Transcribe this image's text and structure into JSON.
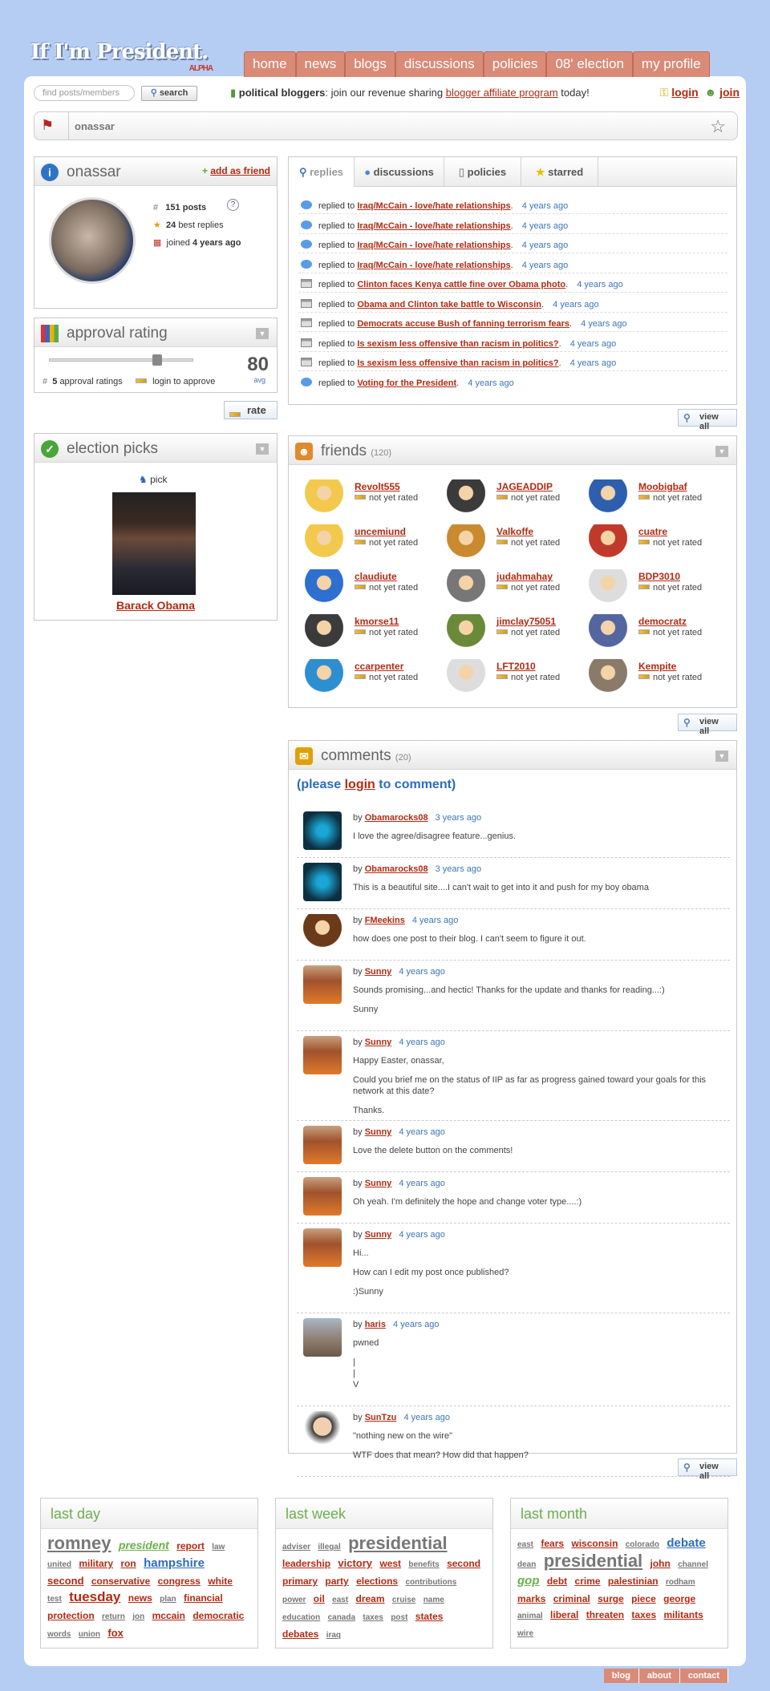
{
  "logo": {
    "title": "If I'm President.",
    "badge": "ALPHA"
  },
  "nav": [
    "home",
    "news",
    "blogs",
    "discussions",
    "policies",
    "08' election",
    "my profile"
  ],
  "search": {
    "placeholder": "find posts/members",
    "button": "search"
  },
  "promo": {
    "bold": "political bloggers",
    "text1": ": join our revenue sharing ",
    "link": "blogger affiliate program",
    "text2": " today!"
  },
  "auth": {
    "login": "login",
    "join": "join"
  },
  "breadcrumb": {
    "name": "onassar"
  },
  "profile": {
    "name": "onassar",
    "add_friend": "add as friend",
    "posts_n": "151",
    "posts_l": "posts",
    "help": "?",
    "best_n": "24",
    "best_l": "best replies",
    "joined_l": "joined",
    "joined_v": "4 years ago"
  },
  "approval": {
    "title": "approval rating",
    "score": "80",
    "avg": "avg",
    "count_n": "5",
    "count_l": "approval ratings",
    "login_approve": "login to approve",
    "rate": "rate",
    "level": 0.8
  },
  "election": {
    "title": "election picks",
    "pick": "pick",
    "candidate": "Barack Obama"
  },
  "tabs": [
    "replies",
    "discussions",
    "policies",
    "starred"
  ],
  "replies": [
    {
      "t": "comment",
      "pre": "replied to",
      "link": "Iraq/McCain - love/hate relationships",
      "time": "4 years ago"
    },
    {
      "t": "comment",
      "pre": "replied to",
      "link": "Iraq/McCain - love/hate relationships",
      "time": "4 years ago"
    },
    {
      "t": "comment",
      "pre": "replied to",
      "link": "Iraq/McCain - love/hate relationships",
      "time": "4 years ago"
    },
    {
      "t": "comment",
      "pre": "replied to",
      "link": "Iraq/McCain - love/hate relationships",
      "time": "4 years ago"
    },
    {
      "t": "cal",
      "pre": "replied to",
      "link": "Clinton faces Kenya cattle fine over Obama photo",
      "time": "4 years ago"
    },
    {
      "t": "cal",
      "pre": "replied to",
      "link": "Obama and Clinton take battle to Wisconsin",
      "time": "4 years ago"
    },
    {
      "t": "cal",
      "pre": "replied to",
      "link": "Democrats accuse Bush of fanning terrorism fears",
      "time": "4 years ago"
    },
    {
      "t": "cal",
      "pre": "replied to",
      "link": "Is sexism less offensive than racism in politics?",
      "time": "4 years ago"
    },
    {
      "t": "cal",
      "pre": "replied to",
      "link": "Is sexism less offensive than racism in politics?",
      "time": "4 years ago"
    },
    {
      "t": "comment",
      "pre": "replied to",
      "link": "Voting for the President",
      "time": "4 years ago"
    }
  ],
  "view_all": "view all",
  "friends": {
    "title": "friends",
    "count": "(120)",
    "status": "not yet rated",
    "list": [
      "Revolt555",
      "JAGEADDIP",
      "Moobigbaf",
      "uncemiund",
      "Valkoffe",
      "cuatre",
      "claudiute",
      "judahmahay",
      "BDP3010",
      "kmorse11",
      "jimclay75051",
      "democratz",
      "ccarpenter",
      "LFT2010",
      "Kempite"
    ]
  },
  "comments": {
    "title": "comments",
    "count": "(20)",
    "prompt_a": "(please ",
    "prompt_link": "login",
    "prompt_b": " to comment)",
    "by": "by",
    "list": [
      {
        "user": "Obamarocks08",
        "time": "3 years ago",
        "lines": [
          "I love the agree/disagree feature...genius."
        ]
      },
      {
        "user": "Obamarocks08",
        "time": "3 years ago",
        "lines": [
          "This is a beautiful site....I can't wait to get into it and push for my boy obama"
        ]
      },
      {
        "user": "FMeekins",
        "time": "4 years ago",
        "lines": [
          "how does one post to their blog. I can't seem to figure it out."
        ]
      },
      {
        "user": "Sunny",
        "time": "4 years ago",
        "lines": [
          "Sounds promising...and hectic! Thanks for the update and thanks for reading...:)",
          "Sunny"
        ]
      },
      {
        "user": "Sunny",
        "time": "4 years ago",
        "lines": [
          "Happy Easter, onassar,",
          "Could you brief me on the status of IIP as far as progress gained toward your goals for this network at this date?",
          "Thanks."
        ]
      },
      {
        "user": "Sunny",
        "time": "4 years ago",
        "lines": [
          "Love the delete button on the comments!"
        ]
      },
      {
        "user": "Sunny",
        "time": "4 years ago",
        "lines": [
          "Oh yeah. I'm definitely the hope and change voter type....:)"
        ]
      },
      {
        "user": "Sunny",
        "time": "4 years ago",
        "lines": [
          "Hi...",
          "How can I edit my post once published?",
          ":)Sunny"
        ]
      },
      {
        "user": "haris",
        "time": "4 years ago",
        "lines": [
          "pwned",
          "|\n|\nV"
        ]
      },
      {
        "user": "SunTzu",
        "time": "4 years ago",
        "lines": [
          "\"nothing new on the wire\"",
          "WTF does that mean? How did that happen?"
        ]
      }
    ]
  },
  "tagclouds": [
    {
      "title": "last day",
      "tags": [
        "romney",
        "president",
        "report",
        "law",
        "united",
        "military",
        "ron",
        "hampshire",
        "second",
        "conservative",
        "congress",
        "white",
        "test",
        "tuesday",
        "news",
        "plan",
        "financial",
        "protection",
        "return",
        "jon",
        "mccain",
        "democratic",
        "words",
        "union",
        "fox"
      ]
    },
    {
      "title": "last week",
      "tags": [
        "adviser",
        "illegal",
        "presidential",
        "leadership",
        "victory",
        "west",
        "benefits",
        "second",
        "primary",
        "party",
        "elections",
        "contributions",
        "power",
        "oil",
        "east",
        "dream",
        "cruise",
        "name",
        "education",
        "canada",
        "taxes",
        "post",
        "states",
        "debates",
        "iraq"
      ]
    },
    {
      "title": "last month",
      "tags": [
        "east",
        "fears",
        "wisconsin",
        "colorado",
        "debate",
        "dean",
        "presidential",
        "john",
        "channel",
        "gop",
        "debt",
        "crime",
        "palestinian",
        "rodham",
        "marks",
        "criminal",
        "surge",
        "piece",
        "george",
        "animal",
        "liberal",
        "threaten",
        "taxes",
        "militants",
        "wire"
      ]
    }
  ],
  "footer": [
    "blog",
    "about",
    "contact"
  ]
}
